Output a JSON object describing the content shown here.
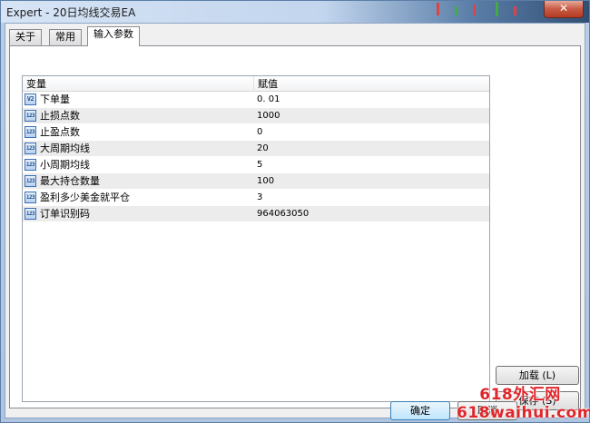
{
  "window": {
    "title": "Expert - 20日均线交易EA",
    "close_label": "✕"
  },
  "tabs": [
    {
      "label": "关于"
    },
    {
      "label": "常用"
    },
    {
      "label": "输入参数"
    }
  ],
  "table": {
    "headers": {
      "variable": "变量",
      "value": "赋值"
    },
    "rows": [
      {
        "icon": "V2",
        "name": "下单量",
        "value": "0. 01"
      },
      {
        "icon": "123",
        "name": "止损点数",
        "value": "1000"
      },
      {
        "icon": "123",
        "name": "止盈点数",
        "value": "0"
      },
      {
        "icon": "123",
        "name": "大周期均线",
        "value": "20"
      },
      {
        "icon": "123",
        "name": "小周期均线",
        "value": "5"
      },
      {
        "icon": "123",
        "name": "最大持仓数量",
        "value": "100"
      },
      {
        "icon": "123",
        "name": "盈利多少美金就平仓",
        "value": "3"
      },
      {
        "icon": "123",
        "name": "订单识别码",
        "value": "964063050"
      }
    ]
  },
  "buttons": {
    "load": "加载 (L)",
    "save": "保存 (S)",
    "ok": "确定",
    "cancel": "取消"
  },
  "watermark": {
    "line1": "618外汇网",
    "line2": "618waihui.com"
  },
  "colors": {
    "watermark": "#e0262b",
    "title_gradient_end": "#324e73",
    "close": "#c75a44"
  }
}
